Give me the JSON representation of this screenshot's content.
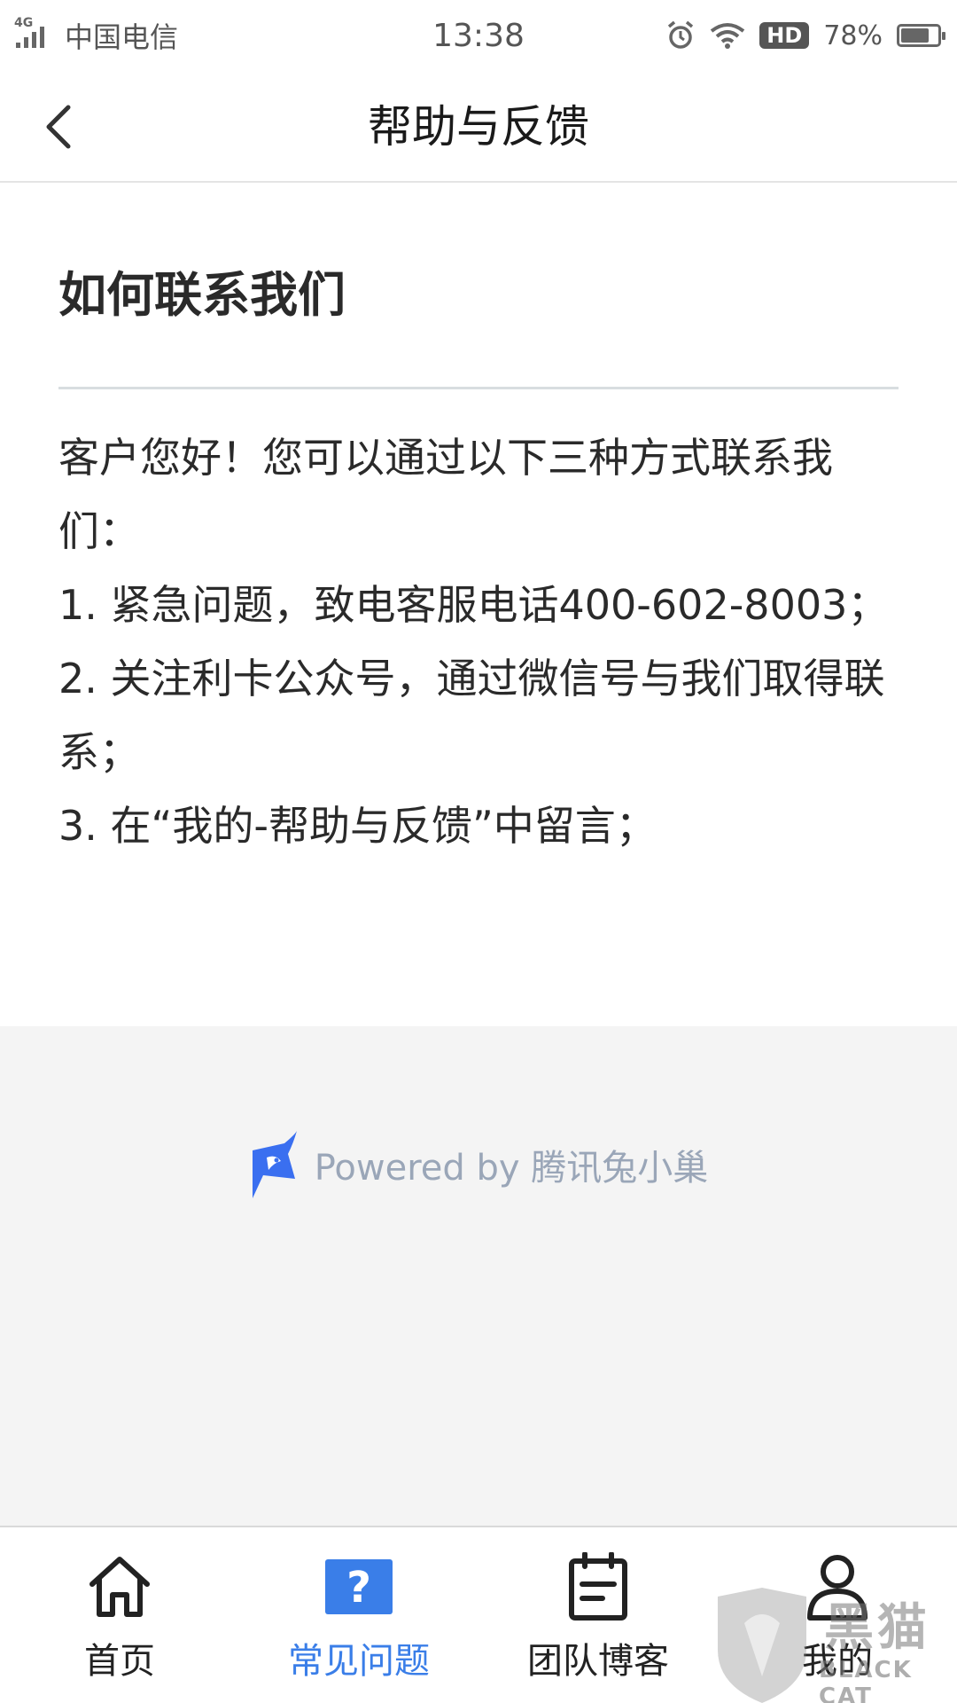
{
  "status_bar": {
    "network": "4G",
    "carrier": "中国电信",
    "time": "13:38",
    "hd": "HD",
    "battery_text": "78%",
    "battery_level": 0.78,
    "icons": [
      "signal-icon",
      "alarm-icon",
      "wifi-icon",
      "battery-icon"
    ]
  },
  "nav": {
    "title": "帮助与反馈",
    "back_icon": "chevron-left-icon"
  },
  "article": {
    "title": "如何联系我们",
    "paragraphs": [
      "客户您好！您可以通过以下三种方式联系我们：",
      "1. 紧急问题，致电客服电话400-602-8003；",
      "2. 关注利卡公众号，通过微信号与我们取得联系；",
      "3. 在“我的-帮助与反馈”中留言；"
    ]
  },
  "powered": {
    "text": "Powered by 腾讯兔小巢",
    "logo_icon": "rabbit-logo-icon",
    "logo_color": "#3a6ff0"
  },
  "tabs": [
    {
      "label": "首页",
      "icon": "home-icon",
      "active": false
    },
    {
      "label": "常见问题",
      "icon": "question-icon",
      "active": true
    },
    {
      "label": "团队博客",
      "icon": "notepad-icon",
      "active": false
    },
    {
      "label": "我的",
      "icon": "user-icon",
      "active": false
    }
  ],
  "colors": {
    "accent": "#3a7ee8",
    "gray_background": "#f4f4f4",
    "text_primary": "#222222"
  },
  "watermark": {
    "cn": "黑猫",
    "en": "BLACK CAT"
  }
}
